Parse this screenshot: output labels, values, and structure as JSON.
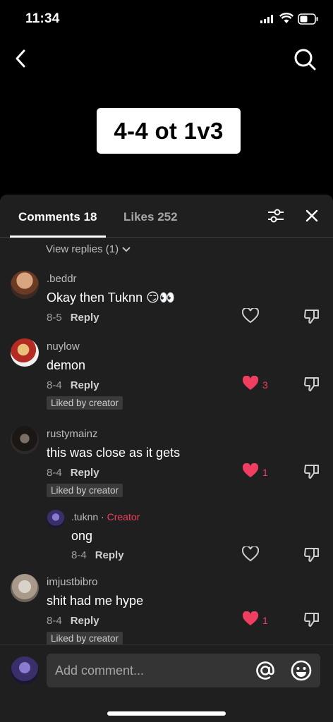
{
  "status_bar": {
    "time": "11:34"
  },
  "video": {
    "title": "4-4 ot 1v3"
  },
  "tabs": {
    "comments_label": "Comments 18",
    "likes_label": "Likes 252"
  },
  "view_replies": "View replies (1)",
  "comments": [
    {
      "username": ".beddr",
      "text": "Okay then Tuknn 😏👀",
      "date": "8-5",
      "reply": "Reply",
      "liked": false,
      "likes": ""
    },
    {
      "username": "nuylow",
      "text": "demon",
      "date": "8-4",
      "reply": "Reply",
      "liked": true,
      "likes": "3",
      "badge": "Liked by creator"
    },
    {
      "username": "rustymainz",
      "text": "this was close as it gets",
      "date": "8-4",
      "reply": "Reply",
      "liked": true,
      "likes": "1",
      "badge": "Liked by creator"
    },
    {
      "username": ".tuknn",
      "creator_sep": "·",
      "creator_label": "Creator",
      "text": "ong",
      "date": "8-4",
      "reply": "Reply",
      "liked": false,
      "likes": ""
    },
    {
      "username": "imjustbibro",
      "text": "shit had me hype",
      "date": "8-4",
      "reply": "Reply",
      "liked": true,
      "likes": "1",
      "badge": "Liked by creator"
    }
  ],
  "composer": {
    "placeholder": "Add comment..."
  },
  "colors": {
    "accent": "#ef3e5f",
    "sheet_bg": "#1f1f1f",
    "badge_bg": "#3a3a3a"
  },
  "icons": [
    "back-icon",
    "search-icon",
    "filter-icon",
    "close-icon",
    "heart-icon",
    "dislike-icon",
    "mention-icon",
    "emoji-icon"
  ]
}
